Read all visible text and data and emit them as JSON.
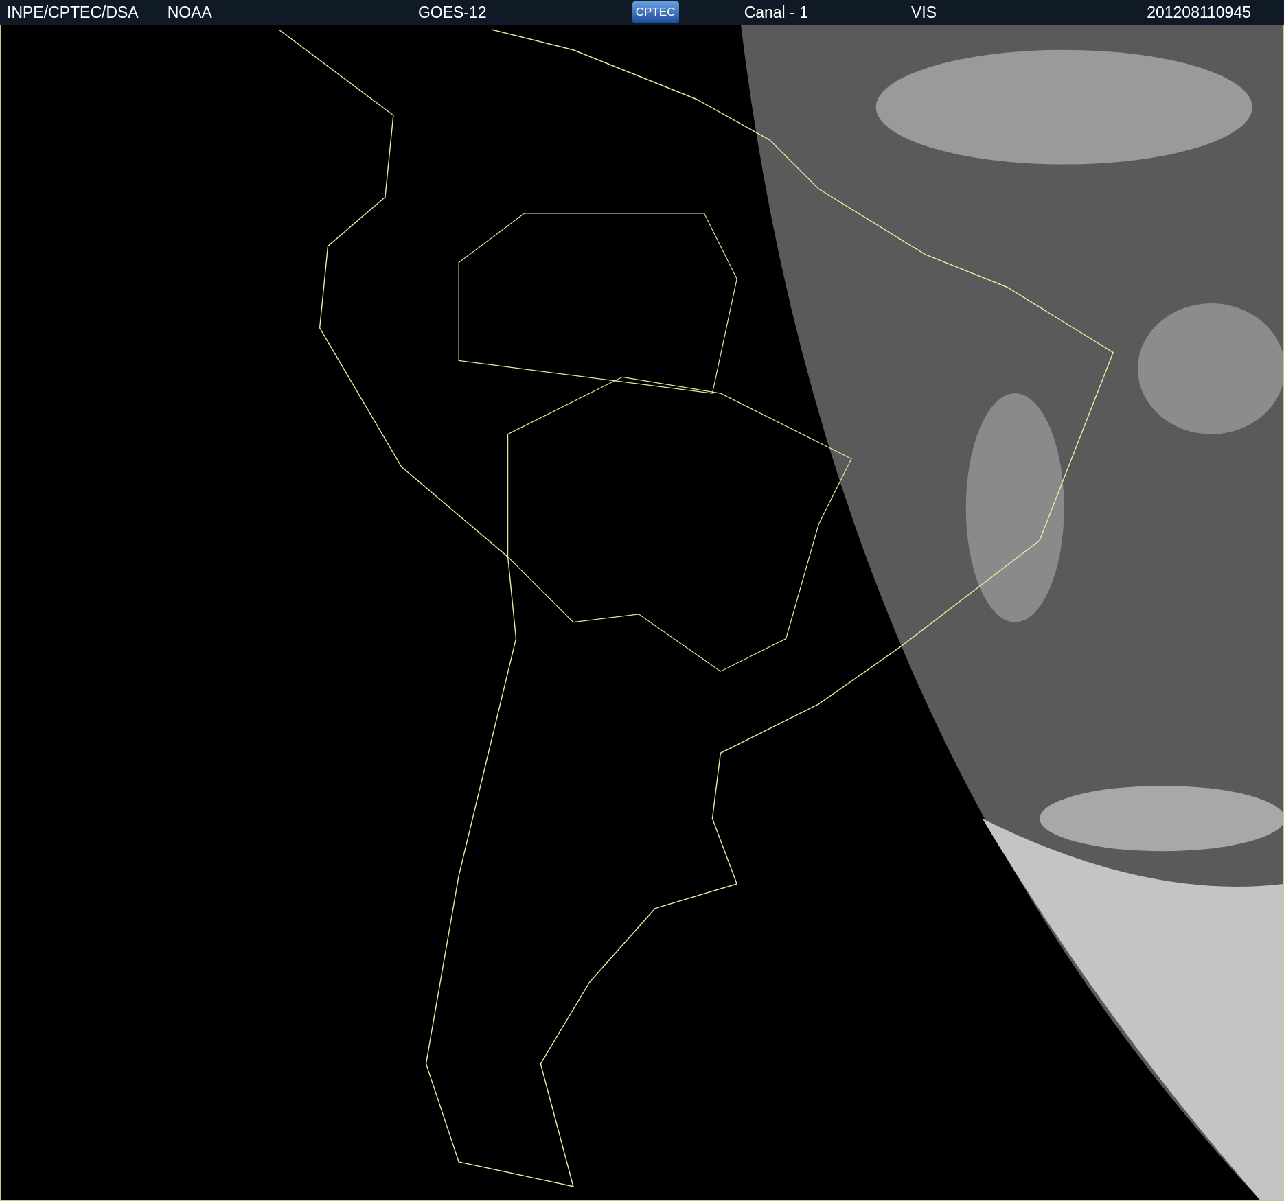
{
  "header": {
    "items": [
      {
        "kind": "text",
        "text": "INPE/CPTEC/DSA"
      },
      {
        "kind": "text",
        "text": "NOAA"
      },
      {
        "kind": "text",
        "text": "GOES-12"
      },
      {
        "kind": "logo",
        "text": "CPTEC"
      },
      {
        "kind": "text",
        "text": "Canal - 1"
      },
      {
        "kind": "text",
        "text": "VIS"
      },
      {
        "kind": "text",
        "text": "201208110945"
      }
    ]
  }
}
